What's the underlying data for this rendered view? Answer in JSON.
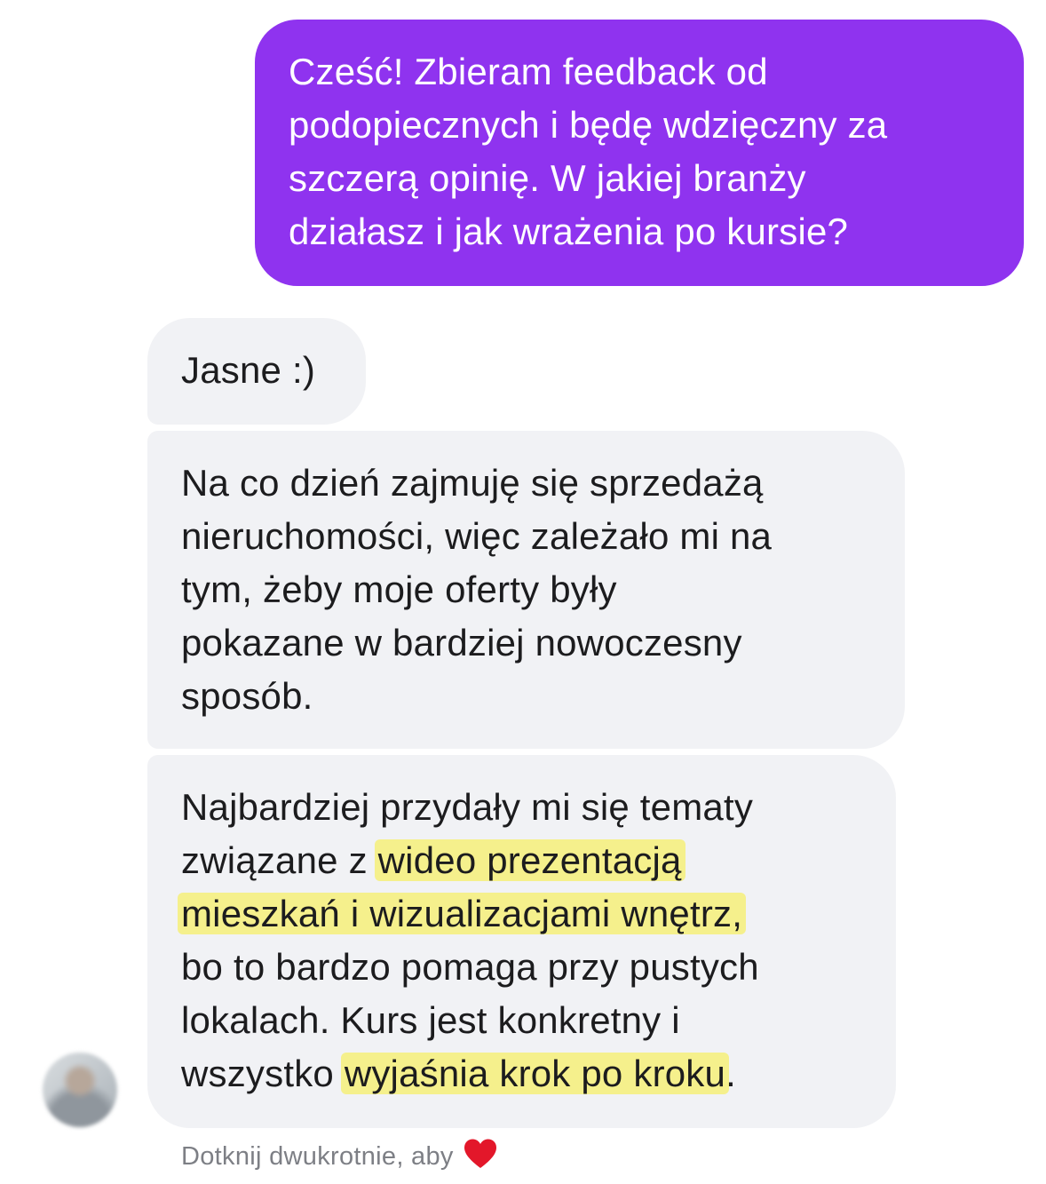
{
  "conversation": {
    "outgoing_message": [
      "Cześć! Zbieram feedback od",
      "podopiecznych i będę wdzięczny za",
      "szczerą opinię. W jakiej branży",
      "działasz i jak wrażenia po kursie?"
    ],
    "reply_1": "Jasne :)",
    "reply_2": [
      "Na co dzień zajmuję się sprzedażą",
      "nieruchomości, więc zależało mi na",
      "tym, żeby moje oferty były",
      "pokazane w bardziej nowoczesny",
      "sposób."
    ],
    "reply_3": {
      "line_1": "Najbardziej przydały mi się tematy",
      "line_2_plain": "związane z ",
      "line_2_highlight": "wideo prezentacją",
      "line_3_highlight": "mieszkań i wizualizacjami wnętrz,",
      "line_4": "bo to bardzo pomaga przy pustych",
      "line_5": "lokalach. Kurs jest konkretny i",
      "line_6_plain": "wszystko ",
      "line_6_highlight": "wyjaśnia krok po kroku",
      "line_6_end": "."
    }
  },
  "footer": {
    "hint": "Dotknij dwukrotnie, aby",
    "icon": "heart-icon"
  },
  "colors": {
    "outgoing_bubble": "#8f33ef",
    "incoming_bubble": "#f1f2f5",
    "highlight": "#f6ef6e"
  }
}
